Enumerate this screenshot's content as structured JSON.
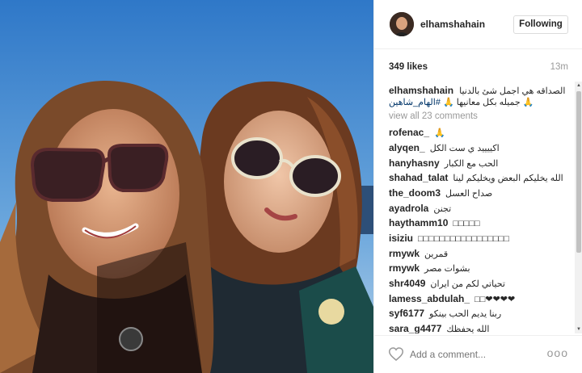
{
  "photo": {
    "alt": ""
  },
  "header": {
    "username": "elhamshahain",
    "follow_label": "Following"
  },
  "stats": {
    "likes": "349 likes",
    "time": "13m"
  },
  "caption": {
    "username": "elhamshahain",
    "text": "الصداقه هي اجمل شئ بالدنيا 🙏 جميله بكل معانيها 🙏",
    "hashtag": "#الهام_شاهين"
  },
  "view_all": "view all 23 comments",
  "comments": [
    {
      "user": "rofenac_",
      "text": "🙏"
    },
    {
      "user": "alyqen_",
      "text": "اكييييد ي ست الكل"
    },
    {
      "user": "hanyhasny",
      "text": "الحب مع الكبار"
    },
    {
      "user": "shahad_talat",
      "text": "الله يخليكم البعض ويخليكم لينا"
    },
    {
      "user": "the_doom3",
      "text": "صداح العسل"
    },
    {
      "user": "ayadrola",
      "text": "تجنن"
    },
    {
      "user": "haythamm10",
      "text": "□□□□□"
    },
    {
      "user": "isiziu",
      "text": "□□□□□□□□□□□□□□□□□"
    },
    {
      "user": "rmywk",
      "text": "قمرين"
    },
    {
      "user": "rmywk",
      "text": "بشوات مصر"
    },
    {
      "user": "shr4049",
      "text": "تحياتي لكم من ايران"
    },
    {
      "user": "lamess_abdulah_",
      "text": "□□❤❤❤❤"
    },
    {
      "user": "syf6177",
      "text": "ربنا يديم الحب بينكو"
    },
    {
      "user": "sara_g4477",
      "text": "الله يحفظك"
    }
  ],
  "footer": {
    "add_comment_placeholder": "Add a comment...",
    "more": "ooo"
  },
  "colors": {
    "border": "#efefef",
    "muted": "#999999",
    "hashtag": "#003569"
  }
}
